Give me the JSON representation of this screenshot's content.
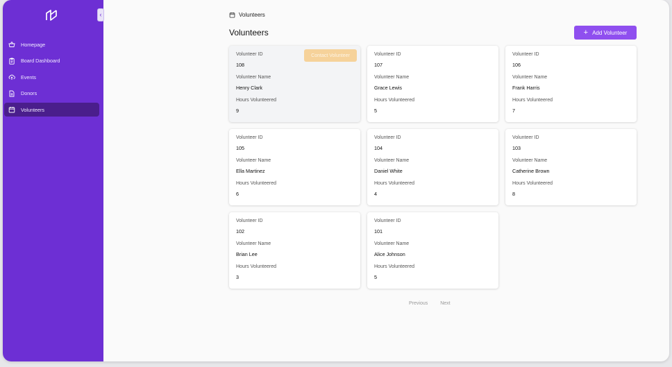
{
  "sidebar": {
    "logo_icon": "brand-logo-icon",
    "collapse_icon": "chevron-left-icon",
    "items": [
      {
        "label": "Homepage",
        "icon": "basket-icon"
      },
      {
        "label": "Board Dashboard",
        "icon": "clipboard-icon"
      },
      {
        "label": "Events",
        "icon": "cloud-upload-icon"
      },
      {
        "label": "Donors",
        "icon": "document-icon"
      },
      {
        "label": "Volunteers",
        "icon": "calendar-icon",
        "active": true
      }
    ],
    "colors": {
      "background": "#6d2fd4",
      "active": "#4a1e8c"
    }
  },
  "breadcrumb": {
    "label": "Volunteers",
    "icon": "calendar-icon"
  },
  "page_title": "Volunteers",
  "add_button": {
    "label": "Add Volunteer",
    "icon": "plus-icon",
    "color": "#8f4fef"
  },
  "card_labels": {
    "id": "Volunteer ID",
    "name": "Volunteer Name",
    "hours": "Hours Volunteered"
  },
  "contact_button": {
    "label": "Contact Volunteer",
    "color": "#f6d29a"
  },
  "volunteers": [
    {
      "id": "108",
      "name": "Henry Clark",
      "hours": "9"
    },
    {
      "id": "107",
      "name": "Grace Lewis",
      "hours": "5"
    },
    {
      "id": "106",
      "name": "Frank Harris",
      "hours": "7"
    },
    {
      "id": "105",
      "name": "Ella Martinez",
      "hours": "6"
    },
    {
      "id": "104",
      "name": "Daniel White",
      "hours": "4"
    },
    {
      "id": "103",
      "name": "Catherine Brown",
      "hours": "8"
    },
    {
      "id": "102",
      "name": "Brian Lee",
      "hours": "3"
    },
    {
      "id": "101",
      "name": "Alice Johnson",
      "hours": "5"
    }
  ],
  "pagination": {
    "previous": "Previous",
    "next": "Next"
  }
}
